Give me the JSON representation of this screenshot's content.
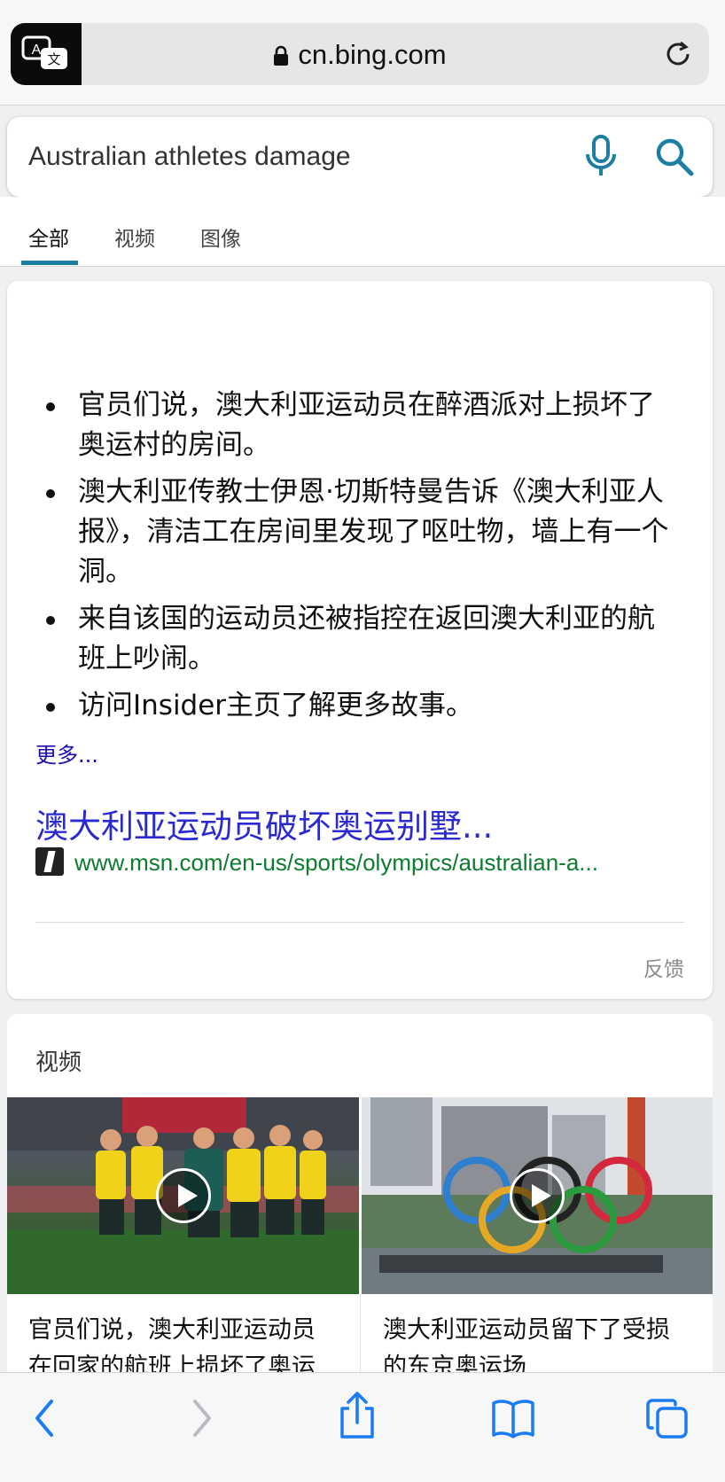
{
  "browser": {
    "url": "cn.bing.com"
  },
  "search": {
    "query": "Australian athletes damage"
  },
  "tabs": [
    {
      "label": "全部"
    },
    {
      "label": "视频"
    },
    {
      "label": "图像"
    }
  ],
  "answer": {
    "bullets": [
      "官员们说，澳大利亚运动员在醉酒派对上损坏了奥运村的房间。",
      "澳大利亚传教士伊恩·切斯特曼告诉《澳大利亚人报》，清洁工在房间里发现了呕吐物，墙上有一个洞。",
      "来自该国的运动员还被指控在返回澳大利亚的航班上吵闹。",
      "访问Insider主页了解更多故事。"
    ],
    "more_label": "更多...",
    "source_title": "澳大利亚运动员破坏奥运别墅...",
    "source_url": "www.msn.com/en-us/sports/olympics/australian-a...",
    "feedback_label": "反馈"
  },
  "videos": {
    "heading": "视频",
    "items": [
      {
        "title": "官员们说，澳大利亚运动员在回家的航班上损坏了奥运"
      },
      {
        "title": "澳大利亚运动员留下了受损的东京奥运场"
      }
    ]
  },
  "colors": {
    "accent": "#1d7ea3",
    "link": "#2a2ad0",
    "url_green": "#0c7c2e",
    "ios_blue": "#1a7cf5"
  },
  "icons": [
    "translate-icon",
    "lock-icon",
    "reload-icon",
    "mic-icon",
    "search-icon",
    "play-icon",
    "back-icon",
    "forward-icon",
    "share-icon",
    "bookmarks-icon",
    "tabs-icon"
  ]
}
